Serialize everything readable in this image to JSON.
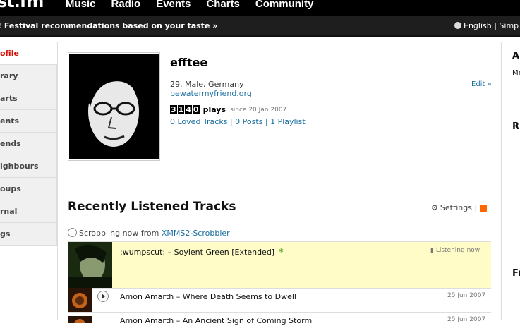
{
  "header": {
    "logo": "st.fm",
    "nav": [
      "Music",
      "Radio",
      "Events",
      "Charts",
      "Community"
    ]
  },
  "banner": {
    "message": "! Festival recommendations based on your taste »",
    "languages": "English | Simp"
  },
  "sidebar": {
    "items": [
      {
        "label": "ofile",
        "active": true
      },
      {
        "label": "rary"
      },
      {
        "label": "arts"
      },
      {
        "label": "ents"
      },
      {
        "label": "ends"
      },
      {
        "label": "ighbours"
      },
      {
        "label": "oups"
      },
      {
        "label": "rnal"
      },
      {
        "label": "gs"
      }
    ]
  },
  "profile": {
    "username": "efftee",
    "details": "29, Male, Germany",
    "url": "bewatermyfriend.org",
    "edit": "Edit »",
    "plays_digits": [
      "3",
      "1",
      "4",
      "0"
    ],
    "plays_label": "plays",
    "since": "since 20 Jan 2007",
    "links": "0 Loved Tracks | 0 Posts | 1 Playlist"
  },
  "recent": {
    "title": "Recently Listened Tracks",
    "settings": "Settings |",
    "scrobbling_prefix": "Scrobbling now from ",
    "scrobbler": "XMMS2-Scrobbler",
    "now_playing": {
      "title": ":wumpscut: – Soylent Green [Extended]",
      "star": "*",
      "status": "Listening now"
    },
    "tracks": [
      {
        "title": "Amon Amarth – Where Death Seems to Dwell",
        "date": "25 Jun 2007"
      },
      {
        "title": "Amon Amarth – An Ancient Sign of Coming Storm",
        "date": "25 Jun 2007"
      }
    ]
  },
  "right_column": {
    "a": "A",
    "m": "Me",
    "r": "R",
    "f": "Fr"
  },
  "colors": {
    "accent": "#d51007",
    "link": "#1a6ea0",
    "now_playing_bg": "#fffcc8"
  }
}
